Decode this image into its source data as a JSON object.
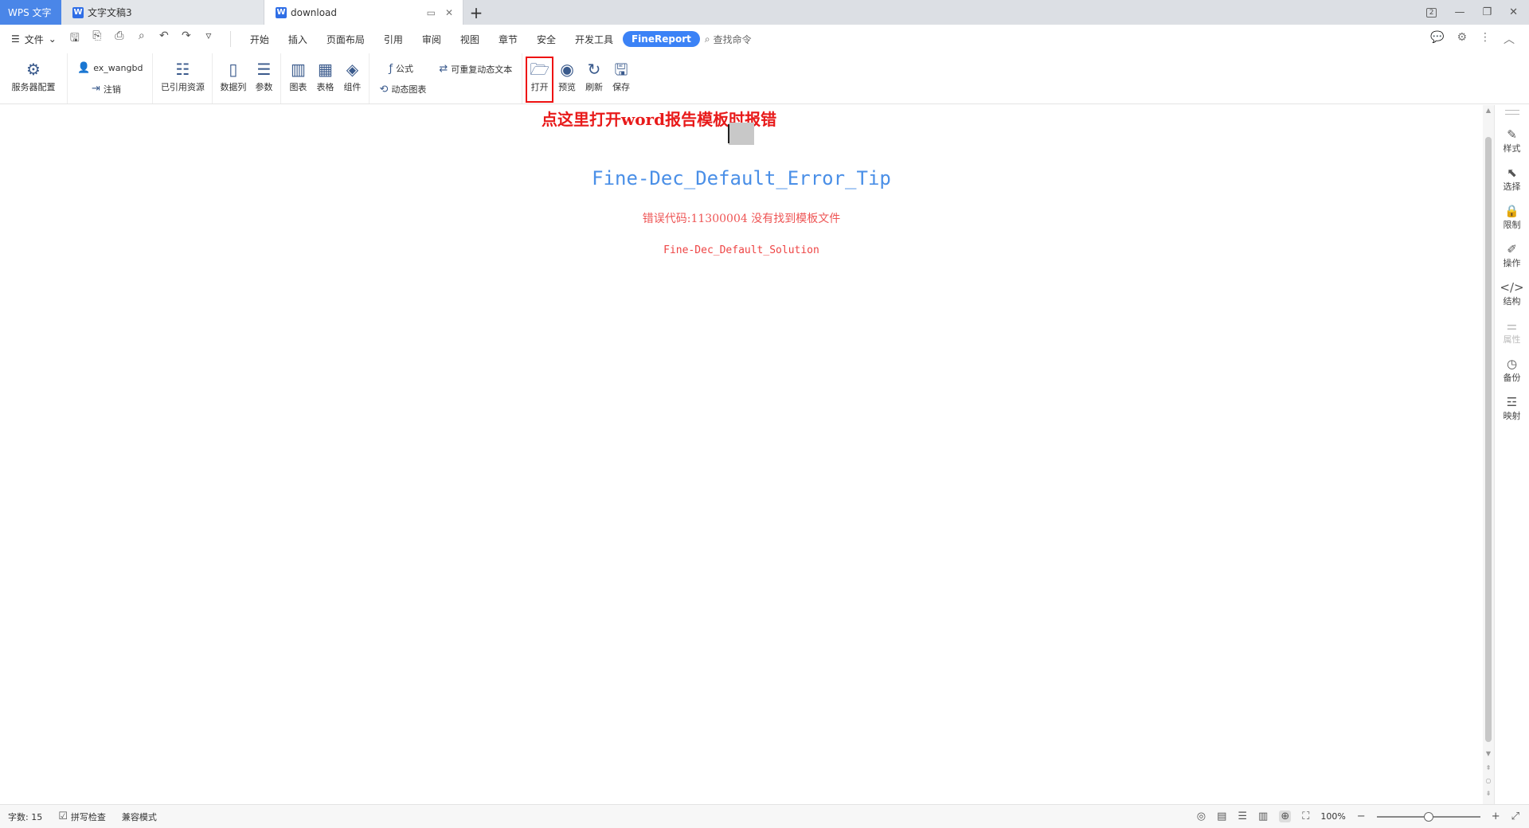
{
  "titlebar": {
    "app_tab": "WPS 文字",
    "tabs": [
      {
        "label": "文字文稿3",
        "icon": "W"
      },
      {
        "label": "download",
        "icon": "W"
      }
    ],
    "new_tab": "+",
    "window_badge": "2"
  },
  "menubar": {
    "file_label": "文件",
    "items": [
      "开始",
      "插入",
      "页面布局",
      "引用",
      "审阅",
      "视图",
      "章节",
      "安全",
      "开发工具",
      "FineReport"
    ],
    "active_item": "FineReport",
    "search_label": "查找命令"
  },
  "ribbon": {
    "server_config": "服务器配置",
    "user_name": "ex_wangbd",
    "logout": "注销",
    "referenced_resources": "已引用资源",
    "data_column": "数据列",
    "parameter": "参数",
    "chart": "图表",
    "table": "表格",
    "component": "组件",
    "formula": "公式",
    "dynamic_chart": "动态图表",
    "repeatable_text": "可重复动态文本",
    "open": "打开",
    "preview": "预览",
    "refresh": "刷新",
    "save": "保存"
  },
  "document": {
    "annotation": "点这里打开word报告模板时报错",
    "error_tip": "Fine-Dec_Default_Error_Tip",
    "error_code": "错误代码:11300004 没有找到模板文件",
    "error_solution": "Fine-Dec_Default_Solution"
  },
  "sidepanel": {
    "items": [
      "样式",
      "选择",
      "限制",
      "操作",
      "结构",
      "属性",
      "备份",
      "映射"
    ]
  },
  "statusbar": {
    "word_count": "字数: 15",
    "spell_check": "拼写检查",
    "compat_mode": "兼容模式",
    "zoom": "100%",
    "zoom_level": 0.5
  },
  "colors": {
    "accent": "#3b82f6",
    "annotation_red": "#e81a1a",
    "error_tip_blue": "#4a8fe7",
    "error_text_red": "#e55555"
  }
}
